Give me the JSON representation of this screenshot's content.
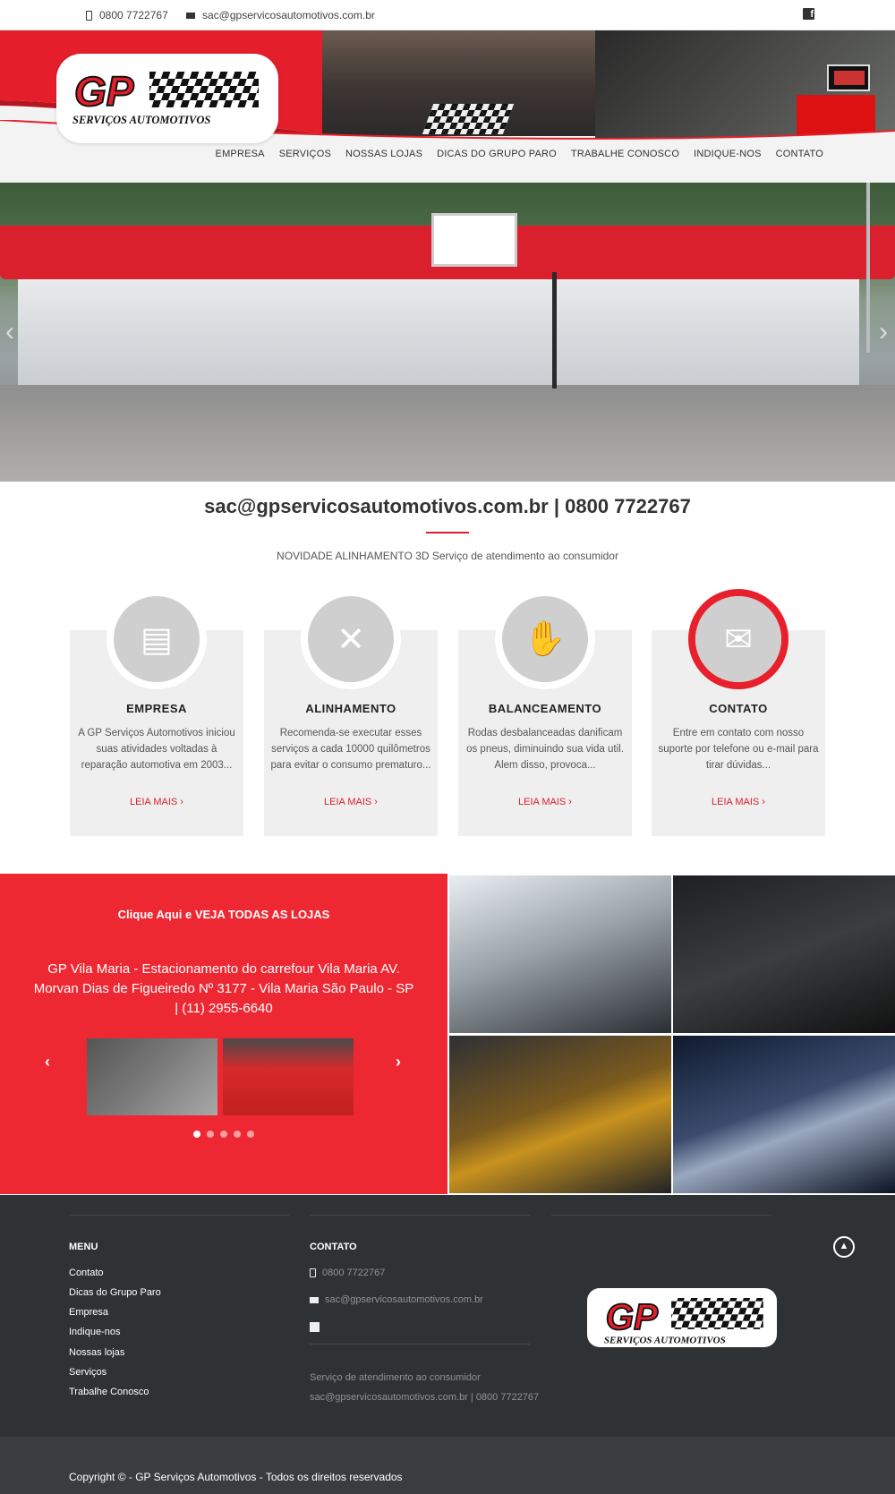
{
  "topbar": {
    "phone": "0800 7722767",
    "email": "sac@gpservicosautomotivos.com.br",
    "social_icon": "facebook-icon"
  },
  "brand": {
    "logo_initials": "GP",
    "logo_tagline": "SERVIÇOS AUTOMOTIVOS",
    "accent_color": "#e8202c"
  },
  "nav": [
    "EMPRESA",
    "SERVIÇOS",
    "NOSSAS LOJAS",
    "DICAS DO GRUPO PARO",
    "TRABALHE CONOSCO",
    "INDIQUE-NOS",
    "CONTATO"
  ],
  "hero": {
    "prev_icon": "chevron-left-icon",
    "next_icon": "chevron-right-icon"
  },
  "intro": {
    "title": "sac@gpservicosautomotivos.com.br | 0800 7722767",
    "subtitle": "NOVIDADE ALINHAMENTO 3D Serviço de atendimento ao consumidor"
  },
  "cards": [
    {
      "icon": "document-icon",
      "title": "EMPRESA",
      "text": "A GP Serviços Automotivos iniciou suas atividades voltadas à reparação automotiva em 2003...",
      "more": "LEIA MAIS"
    },
    {
      "icon": "tools-icon",
      "title": "ALINHAMENTO",
      "text": "Recomenda-se executar esses serviços a cada 10000 quilômetros para evitar o consumo prematuro...",
      "more": "LEIA MAIS"
    },
    {
      "icon": "wrench-hand-icon",
      "title": "BALANCEAMENTO",
      "text": "Rodas desbalanceadas danificam os pneus, diminuindo sua vida util. Alem disso, provoca...",
      "more": "LEIA MAIS"
    },
    {
      "icon": "envelope-icon",
      "title": "CONTATO",
      "text": "Entre em contato com nosso suporte por telefone ou e-mail para tirar dúvidas...",
      "more": "LEIA MAIS"
    }
  ],
  "stores": {
    "cta": "Clique Aqui e VEJA TODAS AS LOJAS",
    "address": "GP Vila Maria - Estacionamento do carrefour Vila Maria AV. Morvan Dias de Figueiredo Nº 3177 - Vila Maria São Paulo - SP | (11) 2955-6640",
    "active_dot": 1,
    "dot_count": 5
  },
  "footer": {
    "menu_title": "MENU",
    "menu": [
      "Contato",
      "Dicas do Grupo Paro",
      "Empresa",
      "Indique-nos",
      "Nossas lojas",
      "Serviços",
      "Trabalhe Conosco"
    ],
    "contact_title": "CONTATO",
    "phone": "0800 7722767",
    "email": "sac@gpservicosautomotivos.com.br",
    "note1": "Serviço de atendimento ao consumidor",
    "note2": "sac@gpservicosautomotivos.com.br | 0800 7722767"
  },
  "copyright": "Copyright © - GP Serviços Automotivos - Todos os direitos reservados"
}
